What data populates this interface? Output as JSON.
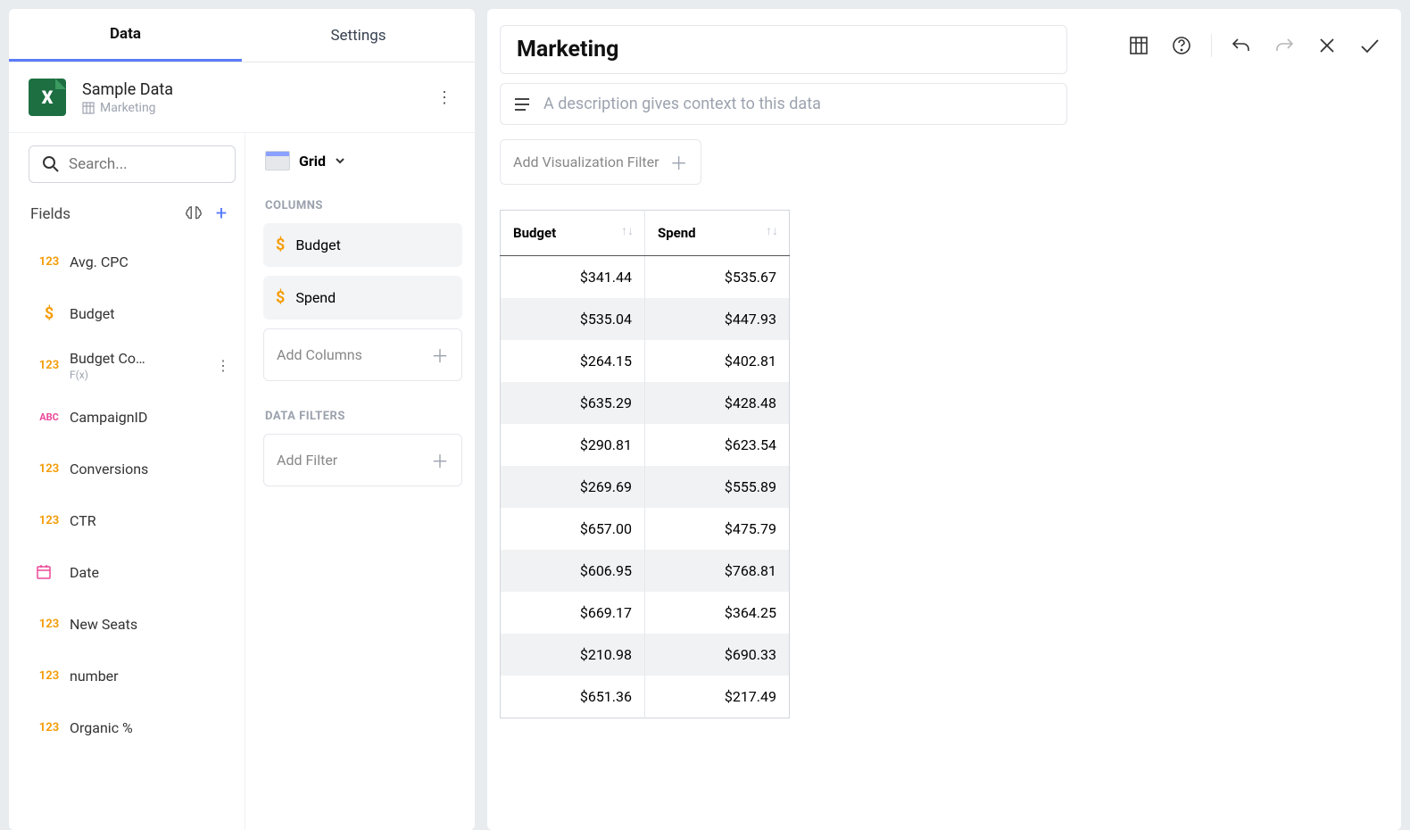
{
  "tabs": {
    "data": "Data",
    "settings": "Settings"
  },
  "datasource": {
    "title": "Sample Data",
    "subtitle": "Marketing"
  },
  "search": {
    "placeholder": "Search..."
  },
  "fields_header": "Fields",
  "fields": [
    {
      "icon": "123",
      "type": "num",
      "label": "Avg. CPC"
    },
    {
      "icon": "$",
      "type": "currency",
      "label": "Budget"
    },
    {
      "icon": "123",
      "type": "num",
      "label": "Budget Co…",
      "sub": "F(x)",
      "more": true
    },
    {
      "icon": "ABC",
      "type": "abc",
      "label": "CampaignID"
    },
    {
      "icon": "123",
      "type": "num",
      "label": "Conversions"
    },
    {
      "icon": "123",
      "type": "num",
      "label": "CTR"
    },
    {
      "icon": "cal",
      "type": "date",
      "label": "Date",
      "expandable": true
    },
    {
      "icon": "123",
      "type": "num",
      "label": "New Seats"
    },
    {
      "icon": "123",
      "type": "num",
      "label": "number"
    },
    {
      "icon": "123",
      "type": "num",
      "label": "Organic %"
    }
  ],
  "viz_type": "Grid",
  "sections": {
    "columns": "COLUMNS",
    "filters": "DATA FILTERS"
  },
  "columns": [
    {
      "label": "Budget"
    },
    {
      "label": "Spend"
    }
  ],
  "add_columns": "Add Columns",
  "add_filter": "Add Filter",
  "viz": {
    "title": "Marketing",
    "desc_placeholder": "A description gives context to this data",
    "add_filter_btn": "Add Visualization Filter"
  },
  "chart_data": {
    "type": "table",
    "headers": [
      "Budget",
      "Spend"
    ],
    "rows": [
      [
        "$341.44",
        "$535.67"
      ],
      [
        "$535.04",
        "$447.93"
      ],
      [
        "$264.15",
        "$402.81"
      ],
      [
        "$635.29",
        "$428.48"
      ],
      [
        "$290.81",
        "$623.54"
      ],
      [
        "$269.69",
        "$555.89"
      ],
      [
        "$657.00",
        "$475.79"
      ],
      [
        "$606.95",
        "$768.81"
      ],
      [
        "$669.17",
        "$364.25"
      ],
      [
        "$210.98",
        "$690.33"
      ],
      [
        "$651.36",
        "$217.49"
      ]
    ]
  }
}
